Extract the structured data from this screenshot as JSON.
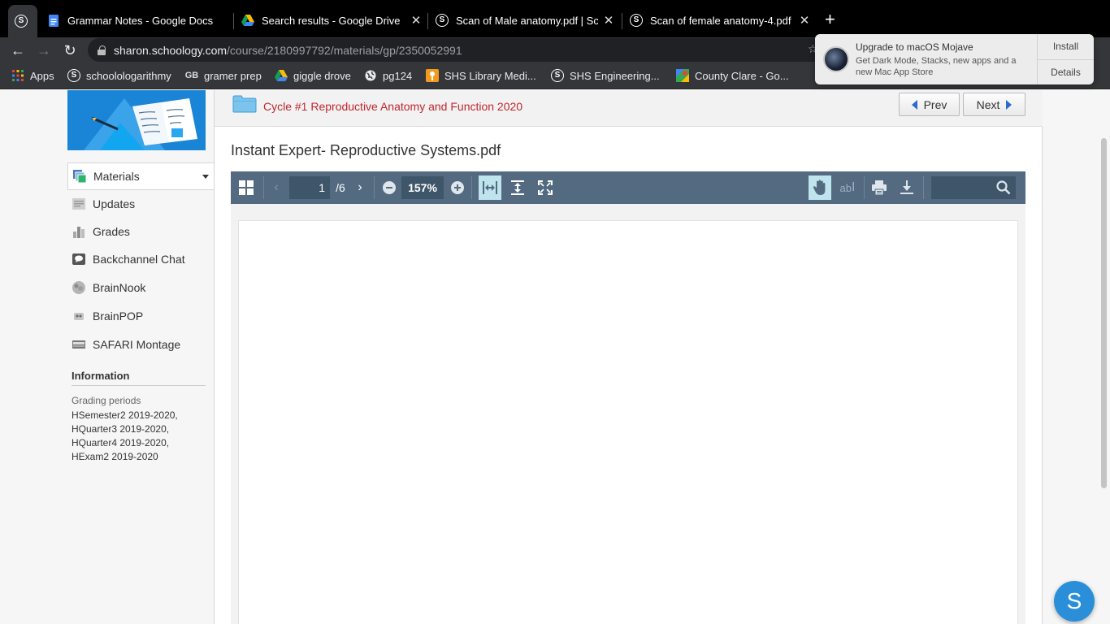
{
  "browser": {
    "tabs": [
      {
        "title": "Grammar Notes - Google Docs",
        "icon": "google-docs-icon"
      },
      {
        "title": "Search results - Google Drive",
        "icon": "google-drive-icon"
      },
      {
        "title": "Scan of Male anatomy.pdf | Sc",
        "icon": "schoology-icon"
      },
      {
        "title": "Scan of female anatomy-4.pdf",
        "icon": "schoology-icon"
      }
    ],
    "new_tab": "+",
    "url_host": "sharon.schoology.com",
    "url_path": "/course/2180997792/materials/gp/2350052991",
    "bookmarks": [
      {
        "label": "Apps",
        "icon": "apps-grid-icon"
      },
      {
        "label": "schoolologarithmy",
        "icon": "schoology-icon"
      },
      {
        "label": "gramer prep",
        "icon": "gb-icon"
      },
      {
        "label": "giggle drove",
        "icon": "google-drive-icon"
      },
      {
        "label": "pg124",
        "icon": "globe-icon"
      },
      {
        "label": "SHS Library Medi...",
        "icon": "library-icon"
      },
      {
        "label": "SHS Engineering...",
        "icon": "schoology-icon"
      },
      {
        "label": "County Clare - Go...",
        "icon": "google-maps-icon"
      }
    ]
  },
  "notification": {
    "title": "Upgrade to macOS Mojave",
    "body": "Get Dark Mode, Stacks, new apps and a new Mac App Store",
    "install": "Install",
    "details": "Details"
  },
  "sidebar": {
    "items": [
      {
        "label": "Materials",
        "icon": "materials-icon"
      },
      {
        "label": "Updates",
        "icon": "updates-icon"
      },
      {
        "label": "Grades",
        "icon": "grades-icon"
      },
      {
        "label": "Backchannel Chat",
        "icon": "chat-icon"
      },
      {
        "label": "BrainNook",
        "icon": "brainnook-icon"
      },
      {
        "label": "BrainPOP",
        "icon": "brainpop-icon"
      },
      {
        "label": "SAFARI Montage",
        "icon": "safari-montage-icon"
      }
    ],
    "info_heading": "Information",
    "grading_label": "Grading periods",
    "grading_periods": [
      "HSemester2 2019-2020,",
      "HQuarter3 2019-2020,",
      "HQuarter4 2019-2020,",
      "HExam2 2019-2020"
    ]
  },
  "main": {
    "breadcrumb": "Cycle #1 Reproductive Anatomy and Function 2020",
    "prev": "Prev",
    "next": "Next",
    "doc_title": "Instant Expert- Reproductive Systems.pdf"
  },
  "viewer": {
    "page_current": "1",
    "page_total": "/6",
    "zoom": "157%"
  },
  "chat_button": "S",
  "colors": {
    "accent_red": "#c0272d",
    "viewer_toolbar": "#536a80",
    "schoology_blue": "#2a8fd8"
  }
}
